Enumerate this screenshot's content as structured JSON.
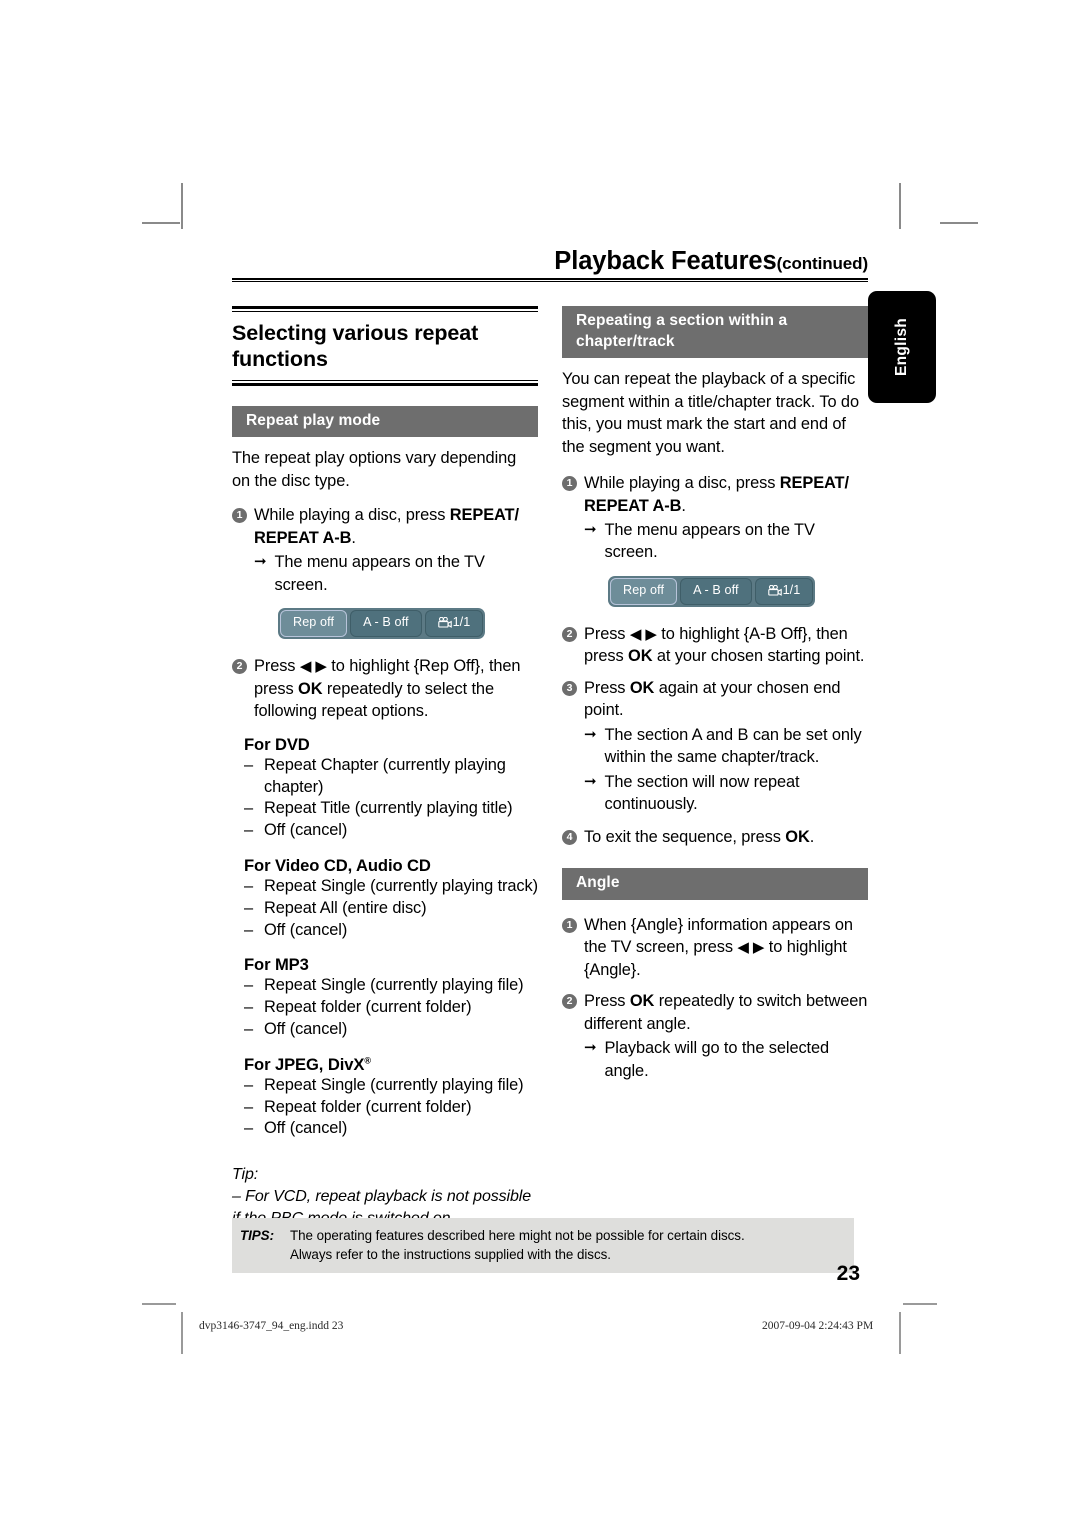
{
  "running_head": {
    "title": "Playback Features",
    "continued": "(continued)"
  },
  "language_tab": {
    "label": "English"
  },
  "left_column": {
    "section_title": "Selecting various repeat functions",
    "subhead": "Repeat play mode",
    "intro": "The repeat play options vary depending on the disc type.",
    "steps": [
      {
        "num": "1",
        "text_before": "While playing a disc, press ",
        "bold": "REPEAT/ REPEAT A-B",
        "text_after": ".",
        "result": "The menu appears on the TV screen."
      },
      {
        "num": "2",
        "text": "Press ◀ ▶ to highlight {Rep Off}, then press OK repeatedly to select the following repeat options."
      }
    ],
    "osd": {
      "buttons": [
        {
          "label": "Rep off",
          "selected": true,
          "icon": ""
        },
        {
          "label": "A - B off",
          "selected": false,
          "icon": ""
        },
        {
          "label": "1/1",
          "selected": false,
          "icon": "camera-angle-icon"
        }
      ]
    },
    "option_groups": [
      {
        "heading": "For DVD",
        "heading_sup": "",
        "items": [
          "Repeat Chapter (currently playing chapter)",
          "Repeat Title (currently playing title)",
          "Off (cancel)"
        ]
      },
      {
        "heading": "For Video CD, Audio CD",
        "heading_sup": "",
        "items": [
          "Repeat Single (currently playing track)",
          "Repeat All (entire disc)",
          "Off (cancel)"
        ]
      },
      {
        "heading": "For MP3",
        "heading_sup": "",
        "items": [
          "Repeat Single (currently playing file)",
          "Repeat folder (current folder)",
          "Off (cancel)"
        ]
      },
      {
        "heading": "For JPEG, DivX",
        "heading_sup": "®",
        "items": [
          "Repeat Single (currently playing file)",
          "Repeat folder (current folder)",
          "Off (cancel)"
        ]
      }
    ],
    "tip_label": "Tip:",
    "tip_text": "–  For VCD, repeat playback is not possible if the PBC mode is switched on."
  },
  "right_column": {
    "subhead_ab": "Repeating a section within a chapter/track",
    "intro_ab": "You can repeat the playback of a specific segment within a title/chapter track. To do this, you must mark the start and end of the segment you want.",
    "osd": {
      "buttons": [
        {
          "label": "Rep off",
          "selected": true,
          "icon": ""
        },
        {
          "label": "A - B off",
          "selected": false,
          "icon": ""
        },
        {
          "label": "1/1",
          "selected": false,
          "icon": "camera-angle-icon"
        }
      ]
    },
    "steps_ab": [
      {
        "num": "1",
        "text_before": "While playing a disc, press ",
        "bold": "REPEAT/ REPEAT A-B",
        "text_after": ".",
        "result": "The menu appears on the TV screen."
      },
      {
        "num": "2",
        "text": "Press ◀ ▶ to highlight {A-B Off}, then press OK at your chosen starting point."
      },
      {
        "num": "3",
        "text": "Press OK again at your chosen end point.",
        "results": [
          "The section A and B can be set only within the same chapter/track.",
          "The section will now repeat continuously."
        ]
      },
      {
        "num": "4",
        "text": "To exit the sequence, press OK."
      }
    ],
    "subhead_angle": "Angle",
    "steps_angle": [
      {
        "num": "1",
        "text": "When {Angle} information appears on the TV screen, press ◀ ▶ to highlight {Angle}."
      },
      {
        "num": "2",
        "text": "Press OK repeatedly to switch between different angle.",
        "results": [
          "Playback will go to the selected angle."
        ]
      }
    ]
  },
  "footer": {
    "tips_label": "TIPS:",
    "tips_line1": "The operating features described here might not be possible for certain discs.",
    "tips_line2": "Always refer to the instructions supplied with the discs.",
    "page_number": "23",
    "file_name": "dvp3146-3747_94_eng.indd   23",
    "timestamp": "2007-09-04   2:24:43 PM"
  },
  "colors": {
    "graybar": "#6e6e6e",
    "osd_bg": "#5c7a85",
    "osd_btn": "#4f717d",
    "osd_btn_selected": "#6e8d99",
    "tipsbar": "#dededc",
    "lang_tab": "#000000"
  }
}
